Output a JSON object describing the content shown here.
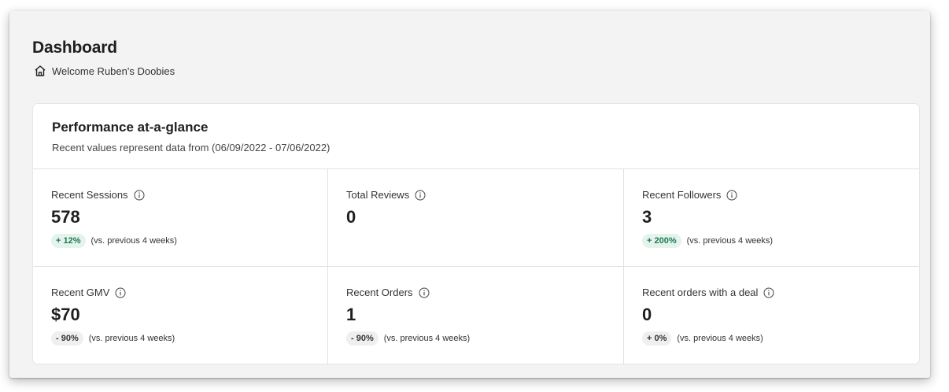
{
  "header": {
    "title": "Dashboard",
    "breadcrumb_icon": "home-icon",
    "breadcrumb_text": "Welcome Ruben's Doobies"
  },
  "performance": {
    "title": "Performance at-a-glance",
    "subtitle": "Recent values represent data from (06/09/2022 - 07/06/2022)",
    "metrics": [
      {
        "label": "Recent Sessions",
        "value": "578",
        "change": "+ 12%",
        "trend": "up",
        "comparison": "(vs. previous 4 weeks)"
      },
      {
        "label": "Total Reviews",
        "value": "0"
      },
      {
        "label": "Recent Followers",
        "value": "3",
        "change": "+ 200%",
        "trend": "up",
        "comparison": "(vs. previous 4 weeks)"
      },
      {
        "label": "Recent GMV",
        "value": "$70",
        "change": "- 90%",
        "trend": "flat",
        "comparison": "(vs. previous 4 weeks)"
      },
      {
        "label": "Recent Orders",
        "value": "1",
        "change": "- 90%",
        "trend": "flat",
        "comparison": "(vs. previous 4 weeks)"
      },
      {
        "label": "Recent orders with a deal",
        "value": "0",
        "change": "+ 0%",
        "trend": "flat",
        "comparison": "(vs. previous 4 weeks)"
      }
    ]
  },
  "colors": {
    "positive_badge_bg": "#e4f3ec",
    "positive_badge_text": "#1c7a52",
    "neutral_badge_bg": "#efefef",
    "page_background": "#f3f3f3"
  }
}
